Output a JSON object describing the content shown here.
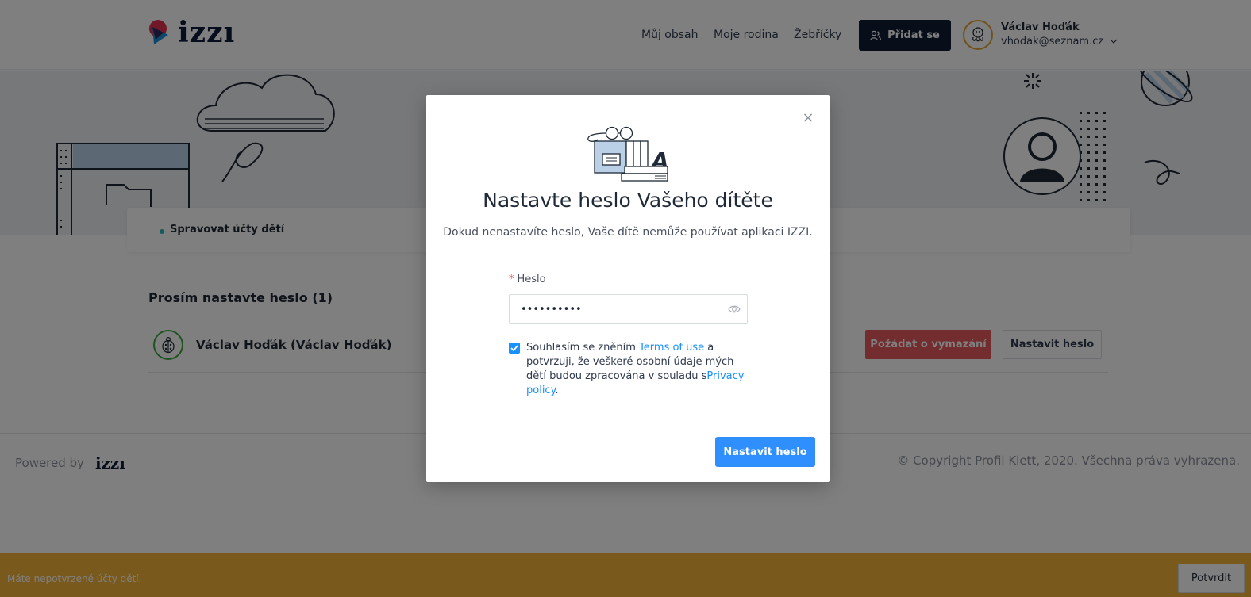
{
  "header": {
    "logo_text": "izzı",
    "nav": [
      {
        "label": "Můj obsah"
      },
      {
        "label": "Moje rodina"
      },
      {
        "label": "Žebříčky"
      }
    ],
    "add_button_label": "Přidat se",
    "user": {
      "name": "Václav Hoďák",
      "email": "vhodak@seznam.cz"
    }
  },
  "infobar": {
    "label": "Spravovat účty dětí"
  },
  "children": {
    "title": "Prosím nastavte heslo (1)",
    "rows": [
      {
        "name": "Václav Hoďák (Václav Hoďák)",
        "delete_label": "Požádat o vymazání",
        "set_label": "Nastavit heslo"
      }
    ]
  },
  "footer": {
    "powered_by": "Powered by",
    "powered_logo": "izzı",
    "copyright": "© Copyright Profil Klett, 2020. Všechna práva vyhrazena."
  },
  "notice": {
    "text": "Máte nepotvrzené účty dětí.",
    "confirm_label": "Potvrdit"
  },
  "modal": {
    "title": "Nastavte heslo Vašeho dítěte",
    "subtitle": "Dokud nenastavíte heslo, Vaše dítě nemůže používat aplikaci IZZI.",
    "password_label": "Heslo",
    "password_value": "••••••••••",
    "consent": {
      "part1": "Souhlasím se zněním ",
      "terms_link": "Terms of use",
      "part2": " a potvrzuji, že veškeré osobní údaje mých dětí budou zpracována v souladu s",
      "privacy_link": "Privacy policy",
      "part3": "."
    },
    "checked": true,
    "submit_label": "Nastavit heslo"
  },
  "colors": {
    "primary": "#2f8fff",
    "navy": "#0f1d35",
    "danger": "#e65a5f",
    "notice": "#f5b339",
    "teal": "#2bb6b8"
  }
}
